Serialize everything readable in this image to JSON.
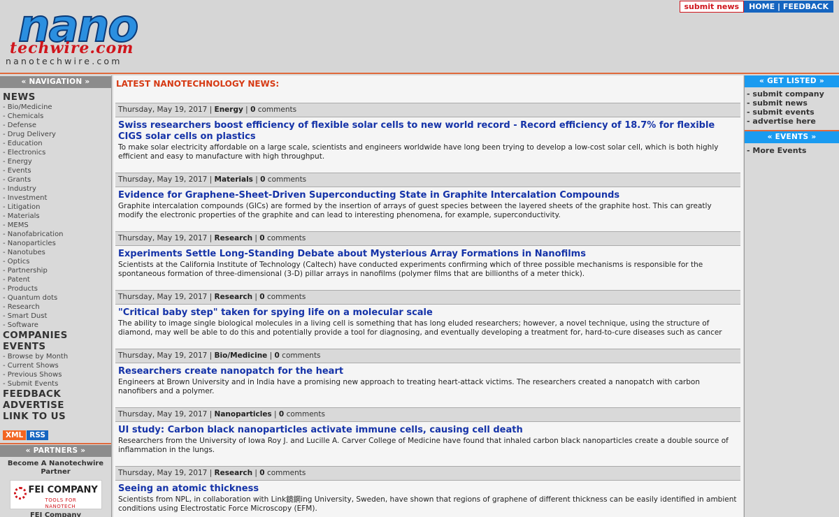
{
  "header": {
    "logo_nano": "nano",
    "logo_techwire": "techwire.com",
    "logo_url": "nanotechwire.com",
    "submit_news": "submit news",
    "home": "HOME",
    "separator": "|",
    "feedback": "FEEDBACK"
  },
  "left": {
    "nav_head": "« NAVIGATION »",
    "news": "NEWS",
    "categories": [
      "- Bio/Medicine",
      "- Chemicals",
      "- Defense",
      "- Drug Delivery",
      "- Education",
      "- Electronics",
      "- Energy",
      "- Events",
      "- Grants",
      "- Industry",
      "- Investment",
      "- Litigation",
      "- Materials",
      "- MEMS",
      "- Nanofabrication",
      "- Nanoparticles",
      "- Nanotubes",
      "- Optics",
      "- Partnership",
      "- Patent",
      "- Products",
      "- Quantum dots",
      "- Research",
      "- Smart Dust",
      "- Software"
    ],
    "companies": "COMPANIES",
    "events": "EVENTS",
    "event_links": [
      "- Browse by Month",
      "- Current Shows",
      "- Previous Shows",
      "- Submit Events"
    ],
    "feedback": "FEEDBACK",
    "advertise": "ADVERTISE",
    "link_to_us": "LINK TO US",
    "xml": "XML",
    "rss": "RSS",
    "partners_head": "« PARTNERS »",
    "partner_cta": "Become A Nanotechwire Partner",
    "fei_name": "FEI COMPANY",
    "fei_tag": "TOOLS FOR NANOTECH",
    "fei_label": "FEI Company"
  },
  "main": {
    "latest_title": "LATEST NANOTECHNOLOGY NEWS:",
    "items": [
      {
        "date": "Thursday, May 19, 2017",
        "category": "Energy",
        "comments": "0",
        "comments_label": "comments",
        "title": "Swiss researchers boost efficiency of flexible solar cells to new world record - Record efficiency of 18.7% for flexible CIGS solar cells on plastics",
        "body": "To make solar electricity affordable on a large scale, scientists and engineers worldwide have long been trying to develop a low-cost solar cell, which is both highly efficient and easy to manufacture with high throughput."
      },
      {
        "date": "Thursday, May 19, 2017",
        "category": "Materials",
        "comments": "0",
        "comments_label": "comments",
        "title": "Evidence for Graphene-Sheet-Driven Superconducting State in Graphite Intercalation Compounds",
        "body": "Graphite intercalation compounds (GICs) are formed by the insertion of arrays of guest species between the layered sheets of the graphite host. This can greatly modify the electronic properties of the graphite and can lead to interesting phenomena, for example, superconductivity."
      },
      {
        "date": "Thursday, May 19, 2017",
        "category": "Research",
        "comments": "0",
        "comments_label": "comments",
        "title": "Experiments Settle Long-Standing Debate about Mysterious Array Formations in Nanofilms",
        "body": "Scientists at the California Institute of Technology (Caltech) have conducted experiments confirming which of three possible mechanisms is responsible for the spontaneous formation of three-dimensional (3-D) pillar arrays in nanofilms (polymer films that are billionths of a meter thick)."
      },
      {
        "date": "Thursday, May 19, 2017",
        "category": "Research",
        "comments": "0",
        "comments_label": "comments",
        "title": "\"Critical baby step\" taken for spying life on a molecular scale",
        "body": "The ability to image single biological molecules in a living cell is something that has long eluded researchers; however, a novel technique, using the structure of diamond, may well be able to do this and potentially provide a tool for diagnosing, and eventually developing a treatment for, hard-to-cure diseases such as cancer"
      },
      {
        "date": "Thursday, May 19, 2017",
        "category": "Bio/Medicine",
        "comments": "0",
        "comments_label": "comments",
        "title": "Researchers create nanopatch for the heart",
        "body": "Engineers at Brown University and in India have a promising new approach to treating heart-attack victims. The researchers created a nanopatch with carbon nanofibers and a polymer."
      },
      {
        "date": "Thursday, May 19, 2017",
        "category": "Nanoparticles",
        "comments": "0",
        "comments_label": "comments",
        "title": "UI study: Carbon black nanoparticles activate immune cells, causing cell death",
        "body": "Researchers from the University of Iowa Roy J. and Lucille A. Carver College of Medicine have found that inhaled carbon black nanoparticles create a double source of inflammation in the lungs."
      },
      {
        "date": "Thursday, May 19, 2017",
        "category": "Research",
        "comments": "0",
        "comments_label": "comments",
        "title": "Seeing an atomic thickness",
        "body": "Scientists from NPL, in collaboration with Link鏡鋼ing University, Sweden, have shown that regions of graphene of different thickness can be easily identified in ambient conditions using Electrostatic Force Microscopy (EFM)."
      }
    ]
  },
  "right": {
    "get_listed_head": "« GET LISTED »",
    "get_listed_links": [
      "- submit company",
      "- submit news",
      "- submit events",
      "- advertise here"
    ],
    "events_head": "« EVENTS »",
    "events_links": [
      "- More Events"
    ]
  }
}
